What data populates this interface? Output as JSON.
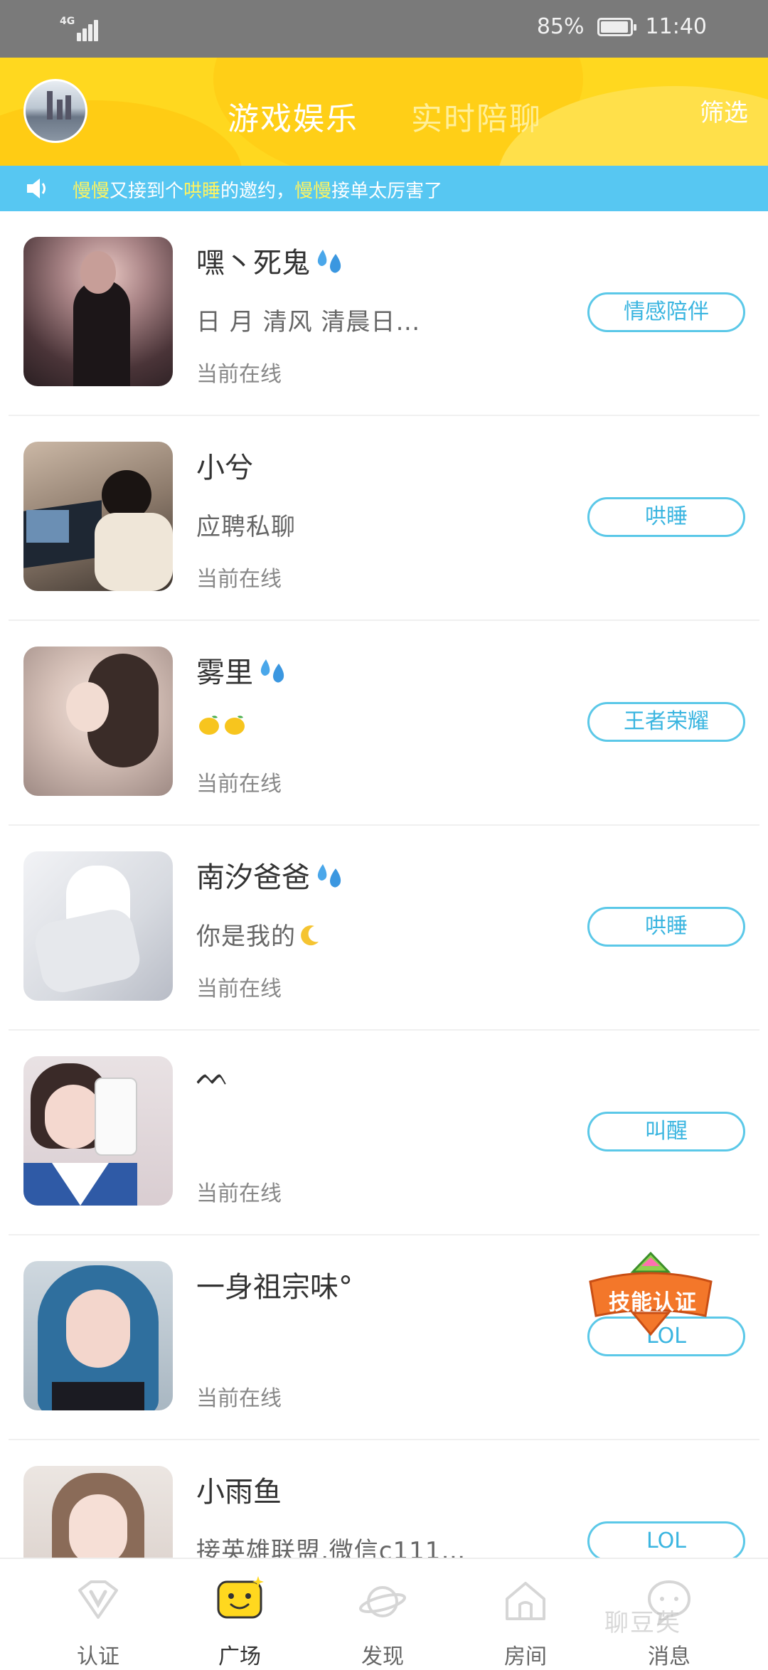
{
  "status_bar": {
    "network": "4G",
    "battery": "85%",
    "time": "11:40",
    "battery_level": 0.85
  },
  "header": {
    "tab_active": "游戏娱乐",
    "tab_inactive": "实时陪聊",
    "filter": "筛选"
  },
  "notice": {
    "name1": "慢慢",
    "part1": "又接到个",
    "service": "哄睡",
    "part2": "的邀约，",
    "name2": "慢慢",
    "part3": "接单太厉害了"
  },
  "users": [
    {
      "name": "嘿丶死鬼",
      "sub": "日 月  清风  清晨日…",
      "status": "当前在线",
      "tag": "情感陪伴"
    },
    {
      "name": "小兮",
      "sub": "应聘私聊",
      "status": "当前在线",
      "tag": "哄睡"
    },
    {
      "name": "雾里",
      "sub": "",
      "status": "当前在线",
      "tag": "王者荣耀"
    },
    {
      "name": "南汐爸爸",
      "sub": "你是我的",
      "status": "当前在线",
      "tag": "哄睡"
    },
    {
      "name": "ᨓ",
      "sub": "",
      "status": "当前在线",
      "tag": "叫醒"
    },
    {
      "name": "一身祖宗味°",
      "sub": "",
      "status": "当前在线",
      "tag": "LOL"
    },
    {
      "name": "小雨鱼",
      "sub": "接英雄联盟,微信c111…",
      "status": "",
      "tag": "LOL"
    }
  ],
  "badge": {
    "text": "技能认证"
  },
  "bottom_nav": [
    {
      "label": "认证",
      "icon": "verify-v-icon"
    },
    {
      "label": "广场",
      "icon": "smiley-square-icon"
    },
    {
      "label": "发现",
      "icon": "planet-icon"
    },
    {
      "label": "房间",
      "icon": "house-icon"
    },
    {
      "label": "消息",
      "icon": "chat-bubble-icon"
    }
  ],
  "watermark": "聊豆芙",
  "colors": {
    "header_yellow": "#ffd81f",
    "notice_blue": "#57c7f2",
    "tag_blue": "#5bc8e8",
    "highlight_yellow": "#fff45f"
  }
}
